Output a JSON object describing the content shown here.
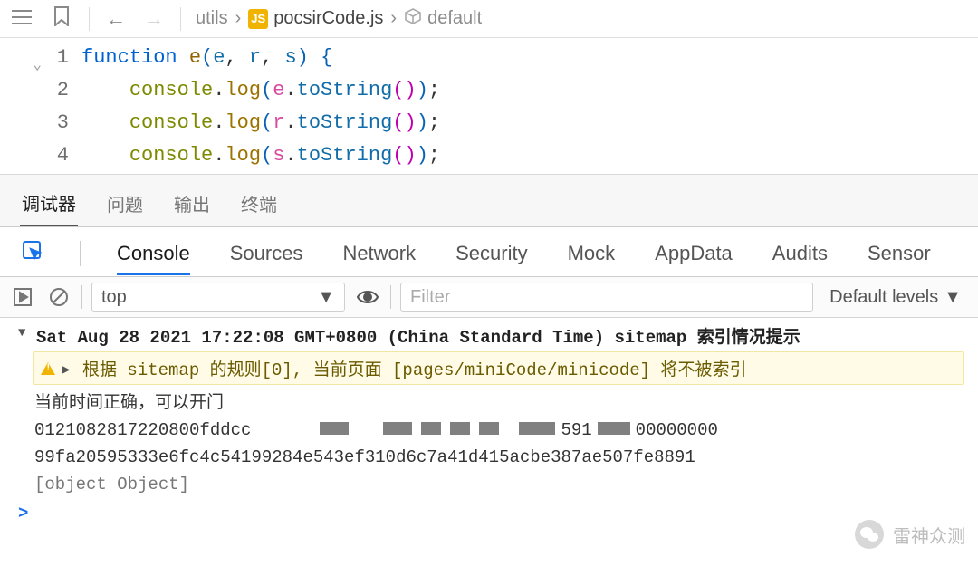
{
  "toolbar": {
    "breadcrumb": {
      "folder": "utils",
      "file": "pocsirCode.js",
      "symbol": "default",
      "file_badge": "JS"
    }
  },
  "code": {
    "lines": [
      {
        "n": "1",
        "tokens": [
          {
            "t": "function",
            "c": "tk-kw"
          },
          {
            "t": " "
          },
          {
            "t": "e",
            "c": "tk-fn"
          },
          {
            "t": "(",
            "c": "tk-paren1"
          },
          {
            "t": "e",
            "c": "tk-var"
          },
          {
            "t": ", "
          },
          {
            "t": "r",
            "c": "tk-var"
          },
          {
            "t": ", "
          },
          {
            "t": "s",
            "c": "tk-var"
          },
          {
            "t": ") ",
            "c": "tk-paren1"
          },
          {
            "t": "{",
            "c": "tk-brace"
          }
        ]
      },
      {
        "n": "2",
        "indent": 1,
        "tokens": [
          {
            "t": "console",
            "c": "tk-name"
          },
          {
            "t": ".",
            "c": "tk-punc"
          },
          {
            "t": "log",
            "c": "tk-method"
          },
          {
            "t": "(",
            "c": "tk-paren1"
          },
          {
            "t": "e",
            "c": "tk-par"
          },
          {
            "t": ".",
            "c": "tk-punc"
          },
          {
            "t": "toString",
            "c": "tk-prop"
          },
          {
            "t": "(",
            "c": "tk-paren2"
          },
          {
            "t": ")",
            "c": "tk-paren2"
          },
          {
            "t": ")",
            "c": "tk-paren1"
          },
          {
            "t": ";",
            "c": "tk-punc"
          }
        ]
      },
      {
        "n": "3",
        "indent": 1,
        "tokens": [
          {
            "t": "console",
            "c": "tk-name"
          },
          {
            "t": ".",
            "c": "tk-punc"
          },
          {
            "t": "log",
            "c": "tk-method"
          },
          {
            "t": "(",
            "c": "tk-paren1"
          },
          {
            "t": "r",
            "c": "tk-par"
          },
          {
            "t": ".",
            "c": "tk-punc"
          },
          {
            "t": "toString",
            "c": "tk-prop"
          },
          {
            "t": "(",
            "c": "tk-paren2"
          },
          {
            "t": ")",
            "c": "tk-paren2"
          },
          {
            "t": ")",
            "c": "tk-paren1"
          },
          {
            "t": ";",
            "c": "tk-punc"
          }
        ]
      },
      {
        "n": "4",
        "indent": 1,
        "tokens": [
          {
            "t": "console",
            "c": "tk-name"
          },
          {
            "t": ".",
            "c": "tk-punc"
          },
          {
            "t": "log",
            "c": "tk-method"
          },
          {
            "t": "(",
            "c": "tk-paren1"
          },
          {
            "t": "s",
            "c": "tk-par"
          },
          {
            "t": ".",
            "c": "tk-punc"
          },
          {
            "t": "toString",
            "c": "tk-prop"
          },
          {
            "t": "(",
            "c": "tk-paren2"
          },
          {
            "t": ")",
            "c": "tk-paren2"
          },
          {
            "t": ")",
            "c": "tk-paren1"
          },
          {
            "t": ";",
            "c": "tk-punc"
          }
        ]
      }
    ]
  },
  "zh_tabs": {
    "items": [
      "调试器",
      "问题",
      "输出",
      "终端"
    ],
    "active_index": 0
  },
  "devtools_tabs": {
    "items": [
      "Console",
      "Sources",
      "Network",
      "Security",
      "Mock",
      "AppData",
      "Audits",
      "Sensor"
    ],
    "active_index": 0
  },
  "console_toolbar": {
    "context": "top",
    "filter_placeholder": "Filter",
    "levels_label": "Default levels"
  },
  "console": {
    "header": "Sat Aug 28 2021 17:22:08 GMT+0800 (China Standard Time) sitemap 索引情况提示",
    "warn": "根据 sitemap 的规则[0], 当前页面 [pages/miniCode/minicode] 将不被索引",
    "lines": [
      "当前时间正确，可以开门",
      "0121082817220800fddcc",
      "591",
      "00000000",
      "99fa20595333e6fc4c54199284e543ef310d6c7a41d415acbe387ae507fe8891",
      "[object Object]"
    ],
    "prompt": ">"
  },
  "watermark": {
    "text": "雷神众测"
  }
}
